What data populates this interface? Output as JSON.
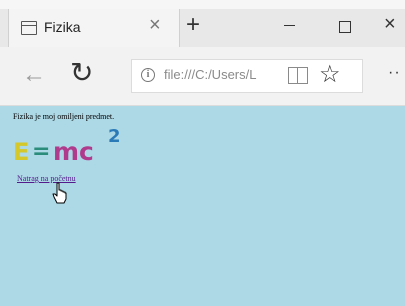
{
  "browser": {
    "tab_title": "Fizika",
    "tab_close": "×",
    "new_tab": "+",
    "window_controls": {
      "minimize": "minimize-icon",
      "maximize": "maximize-icon",
      "close": "×"
    },
    "nav": {
      "back": "←",
      "refresh": "↻",
      "more": "··"
    },
    "address": {
      "info": "i",
      "url": "file:///C:/Users/L",
      "star": "☆"
    }
  },
  "page": {
    "paragraph": "Fizika je moj omiljeni predmet.",
    "formula": {
      "e": "E",
      "eq": "=",
      "mc": "mc",
      "sup": "2"
    },
    "link": "Natrag na početnu"
  },
  "colors": {
    "content_bg": "#add8e6",
    "link": "#551a8b",
    "formula_e": "#d4c82a",
    "formula_eq": "#2a8c7a",
    "formula_mc": "#b03a8c",
    "formula_sup": "#2a7ab8"
  }
}
